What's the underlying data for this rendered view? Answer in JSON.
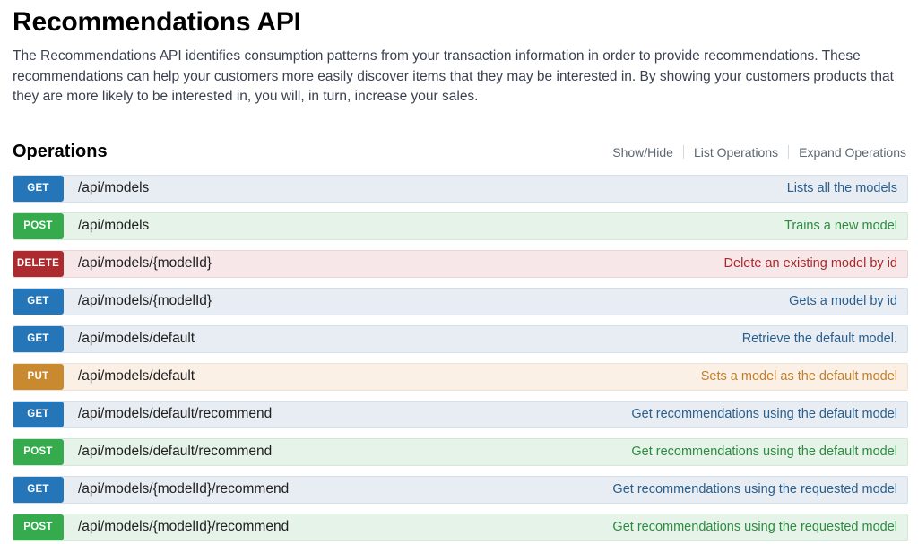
{
  "header": {
    "title": "Recommendations API",
    "description": "The Recommendations API identifies consumption patterns from your transaction information in order to provide recommendations. These recommendations can help your customers more easily discover items that they may be interested in. By showing your customers products that they are more likely to be interested in, you will, in turn, increase your sales."
  },
  "operations_section": {
    "title": "Operations",
    "links": {
      "show_hide": "Show/Hide",
      "list_operations": "List Operations",
      "expand_operations": "Expand Operations"
    }
  },
  "method_colors": {
    "get": "#2576b9",
    "post": "#36ab4d",
    "delete": "#ad2b2e",
    "put": "#c8892f"
  },
  "operations": [
    {
      "method": "GET",
      "path": "/api/models",
      "summary": "Lists all the models"
    },
    {
      "method": "POST",
      "path": "/api/models",
      "summary": "Trains a new model"
    },
    {
      "method": "DELETE",
      "path": "/api/models/{modelId}",
      "summary": "Delete an existing model by id"
    },
    {
      "method": "GET",
      "path": "/api/models/{modelId}",
      "summary": "Gets a model by id"
    },
    {
      "method": "GET",
      "path": "/api/models/default",
      "summary": "Retrieve the default model."
    },
    {
      "method": "PUT",
      "path": "/api/models/default",
      "summary": "Sets a model as the default model"
    },
    {
      "method": "GET",
      "path": "/api/models/default/recommend",
      "summary": "Get recommendations using the default model"
    },
    {
      "method": "POST",
      "path": "/api/models/default/recommend",
      "summary": "Get recommendations using the default model"
    },
    {
      "method": "GET",
      "path": "/api/models/{modelId}/recommend",
      "summary": "Get recommendations using the requested model"
    },
    {
      "method": "POST",
      "path": "/api/models/{modelId}/recommend",
      "summary": "Get recommendations using the requested model"
    }
  ]
}
